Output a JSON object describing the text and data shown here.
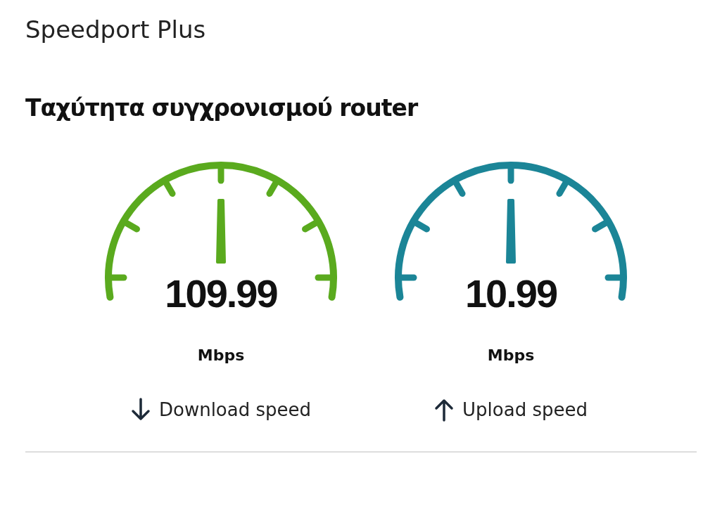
{
  "router_type": {
    "value": "Speedport Plus"
  },
  "sync_speed": {
    "title": "Ταχύτητα συγχρονισμού router",
    "gauges": [
      {
        "kind": "download",
        "color": "#5aaa1e",
        "value": "109.99",
        "unit": "Mbps",
        "label": "Download speed"
      },
      {
        "kind": "upload",
        "color": "#1b8597",
        "value": "10.99",
        "unit": "Mbps",
        "label": "Upload speed"
      }
    ]
  }
}
